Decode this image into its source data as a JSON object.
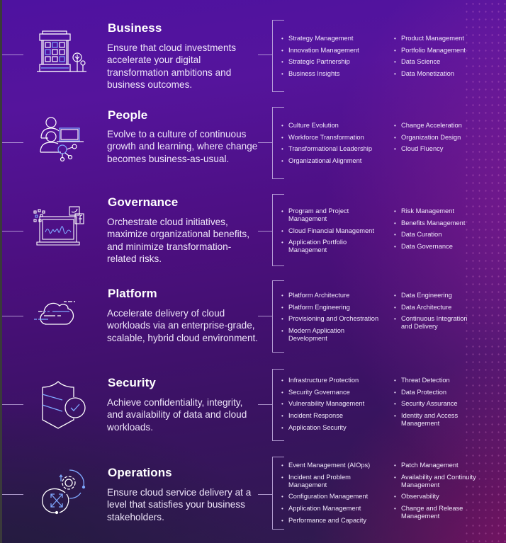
{
  "colors": {
    "bg_top_left": "#4e12a0",
    "bg_top_right": "#a33bb0",
    "bg_bottom_left": "#2d1b4b",
    "bg_bottom_right": "#8a1068",
    "line": "#c7b3e4",
    "icon_stroke": "#ffffff",
    "icon_accent": "#7fa8ff"
  },
  "sections": [
    {
      "title": "Business",
      "icon": "building-icon",
      "description": "Ensure that cloud investments accelerate your digital transformation ambitions and business outcomes.",
      "col1": [
        "Strategy Management",
        "Innovation Management",
        "Strategic Partnership",
        "Business Insights"
      ],
      "col2": [
        "Product Management",
        "Portfolio Management",
        "Data Science",
        "Data Monetization"
      ]
    },
    {
      "title": "People",
      "icon": "people-network-icon",
      "description": "Evolve to a culture of continuous growth and learning, where change becomes business-as-usual.",
      "col1": [
        "Culture Evolution",
        "Workforce Transformation",
        "Transformational Leadership",
        "Organizational Alignment"
      ],
      "col2": [
        "Change Acceleration",
        "Organization Design",
        "Cloud Fluency"
      ]
    },
    {
      "title": "Governance",
      "icon": "laptop-social-icon",
      "description": "Orchestrate cloud initiatives, maximize organizational benefits, and minimize transformation-related risks.",
      "col1": [
        "Program and Project Management",
        "Cloud Financial Management",
        "Application Portfolio Management"
      ],
      "col2": [
        "Risk Management",
        "Benefits Management",
        "Data Curation",
        "Data Governance"
      ]
    },
    {
      "title": "Platform",
      "icon": "cloud-icon",
      "description": "Accelerate delivery of cloud workloads via an enterprise-grade, scalable, hybrid cloud environment.",
      "col1": [
        "Platform Architecture",
        "Platform Engineering",
        "Provisioning and Orchestration",
        "Modern Application Development"
      ],
      "col2": [
        "Data Engineering",
        "Data Architecture",
        "Continuous Integration and Delivery"
      ]
    },
    {
      "title": "Security",
      "icon": "shield-check-icon",
      "description": "Achieve confidentiality, integrity, and availability of data and cloud workloads.",
      "col1": [
        "Infrastructure Protection",
        "Security Governance",
        "Vulnerability Management",
        "Incident Response",
        "Application Security"
      ],
      "col2": [
        "Threat Detection",
        "Data Protection",
        "Security Assurance",
        "Identity and Access Management"
      ]
    },
    {
      "title": "Operations",
      "icon": "gear-cycle-icon",
      "description": "Ensure cloud service delivery at a level that satisfies your business stakeholders.",
      "col1": [
        "Event Management (AIOps)",
        "Incident and Problem Management",
        "Configuration Management",
        "Application Management",
        "Performance and Capacity"
      ],
      "col2": [
        "Patch Management",
        "Availability and Continuity Management",
        "Observability",
        "Change and Release Management"
      ]
    }
  ]
}
